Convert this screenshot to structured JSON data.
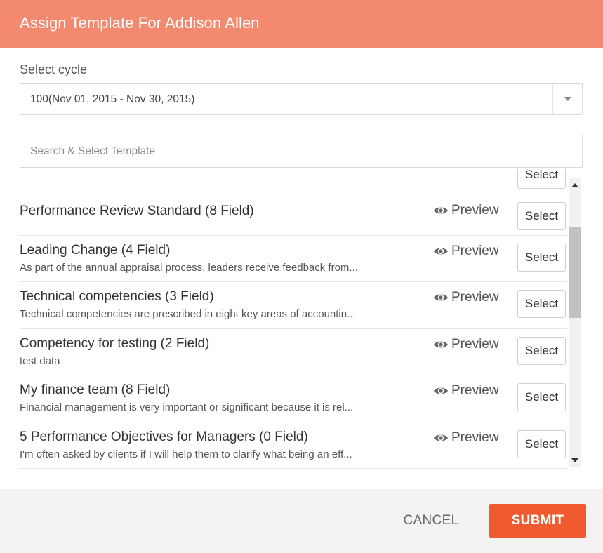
{
  "dialog": {
    "title": "Assign Template For Addison Allen"
  },
  "cycle": {
    "label": "Select cycle",
    "selected": "100(Nov 01, 2015 - Nov 30, 2015)"
  },
  "search": {
    "placeholder": "Search & Select Template"
  },
  "templates": {
    "preview_label": "Preview",
    "select_label": "Select",
    "items": [
      {
        "title": "Performance Review Standard (8 Field)",
        "description": ""
      },
      {
        "title": "Leading Change (4 Field)",
        "description": "As part of the annual appraisal process, leaders receive feedback from..."
      },
      {
        "title": "Technical competencies (3 Field)",
        "description": "Technical competencies are prescribed in eight key areas of accountin..."
      },
      {
        "title": "Competency for testing (2 Field)",
        "description": "test data"
      },
      {
        "title": "My finance team (8 Field)",
        "description": "Financial management is very important or significant because it is rel..."
      },
      {
        "title": "5 Performance Objectives for Managers (0 Field)",
        "description": "I'm often asked by clients if I will help them to clarify what being an eff..."
      }
    ]
  },
  "footer": {
    "cancel_label": "CANCEL",
    "submit_label": "SUBMIT"
  },
  "colors": {
    "header": "#f3896e",
    "submit": "#ef5a2f",
    "footer_bg": "#f4f3f1"
  },
  "icons": {
    "preview": "eye-icon",
    "dropdown": "chevron-down-icon",
    "scroll_up": "scroll-up-arrow-icon",
    "scroll_down": "scroll-down-arrow-icon"
  }
}
